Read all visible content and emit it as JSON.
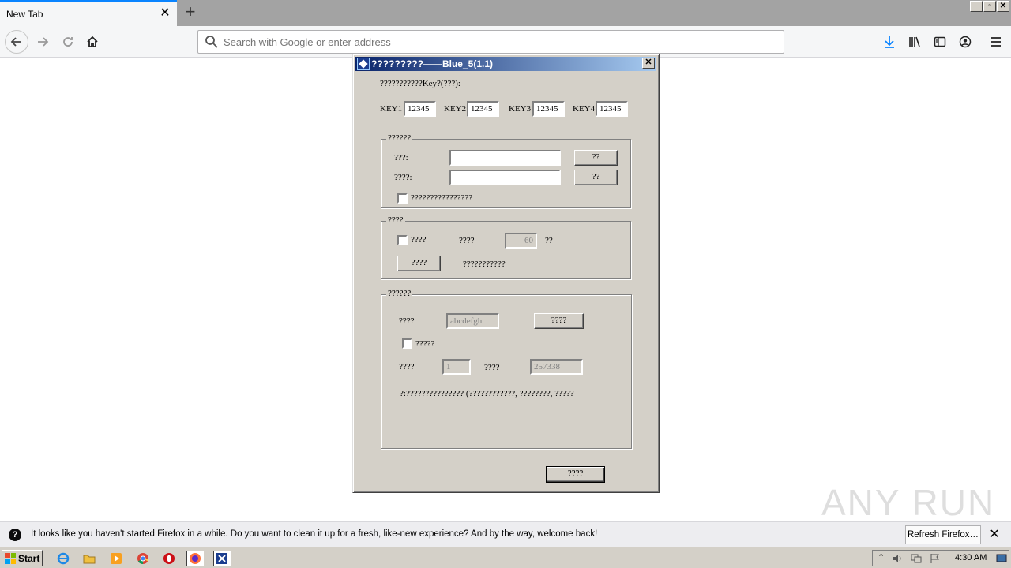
{
  "browser": {
    "tab_title": "New Tab",
    "tab_close": "✕",
    "new_tab": "+",
    "url_placeholder": "Search with Google or enter address",
    "window_buttons": [
      "_",
      "▫",
      "✕"
    ]
  },
  "dialog": {
    "title": "?????????——Blue_5(1.1)",
    "close": "✕",
    "key_prompt": "???????????Key?(???):",
    "keys": [
      {
        "label": "KEY1",
        "value": "12345"
      },
      {
        "label": "KEY2",
        "value": "12345"
      },
      {
        "label": "KEY3",
        "value": "12345"
      },
      {
        "label": "KEY4",
        "value": "12345"
      }
    ],
    "group1": {
      "legend": "??????",
      "row1_label": "???:",
      "row1_button": "??",
      "row2_label": "????:",
      "row2_button": "??",
      "checkbox_label": "????????????????"
    },
    "group2": {
      "legend": "????",
      "checkbox_label": "????",
      "interval_label": "????",
      "interval_value": "60",
      "interval_unit": "??",
      "button": "????",
      "status": "???????????"
    },
    "group3": {
      "legend": "??????",
      "field1_label": "????",
      "field1_value": "abcdefgh",
      "field1_button": "????",
      "checkbox_label": "?????",
      "field2_label": "????",
      "field2_value": "1",
      "field3_label": "????",
      "field3_value": "257338",
      "note": "?:??????????????? (????????????, ????????, ?????"
    },
    "ok_button": "????"
  },
  "notification": {
    "text": "It looks like you haven't started Firefox in a while. Do you want to clean it up for a fresh, like-new experience? And by the way, welcome back!",
    "button": "Refresh Firefox…",
    "close": "✕"
  },
  "watermark": "ANY RUN",
  "taskbar": {
    "start": "Start",
    "clock": "4:30 AM"
  }
}
